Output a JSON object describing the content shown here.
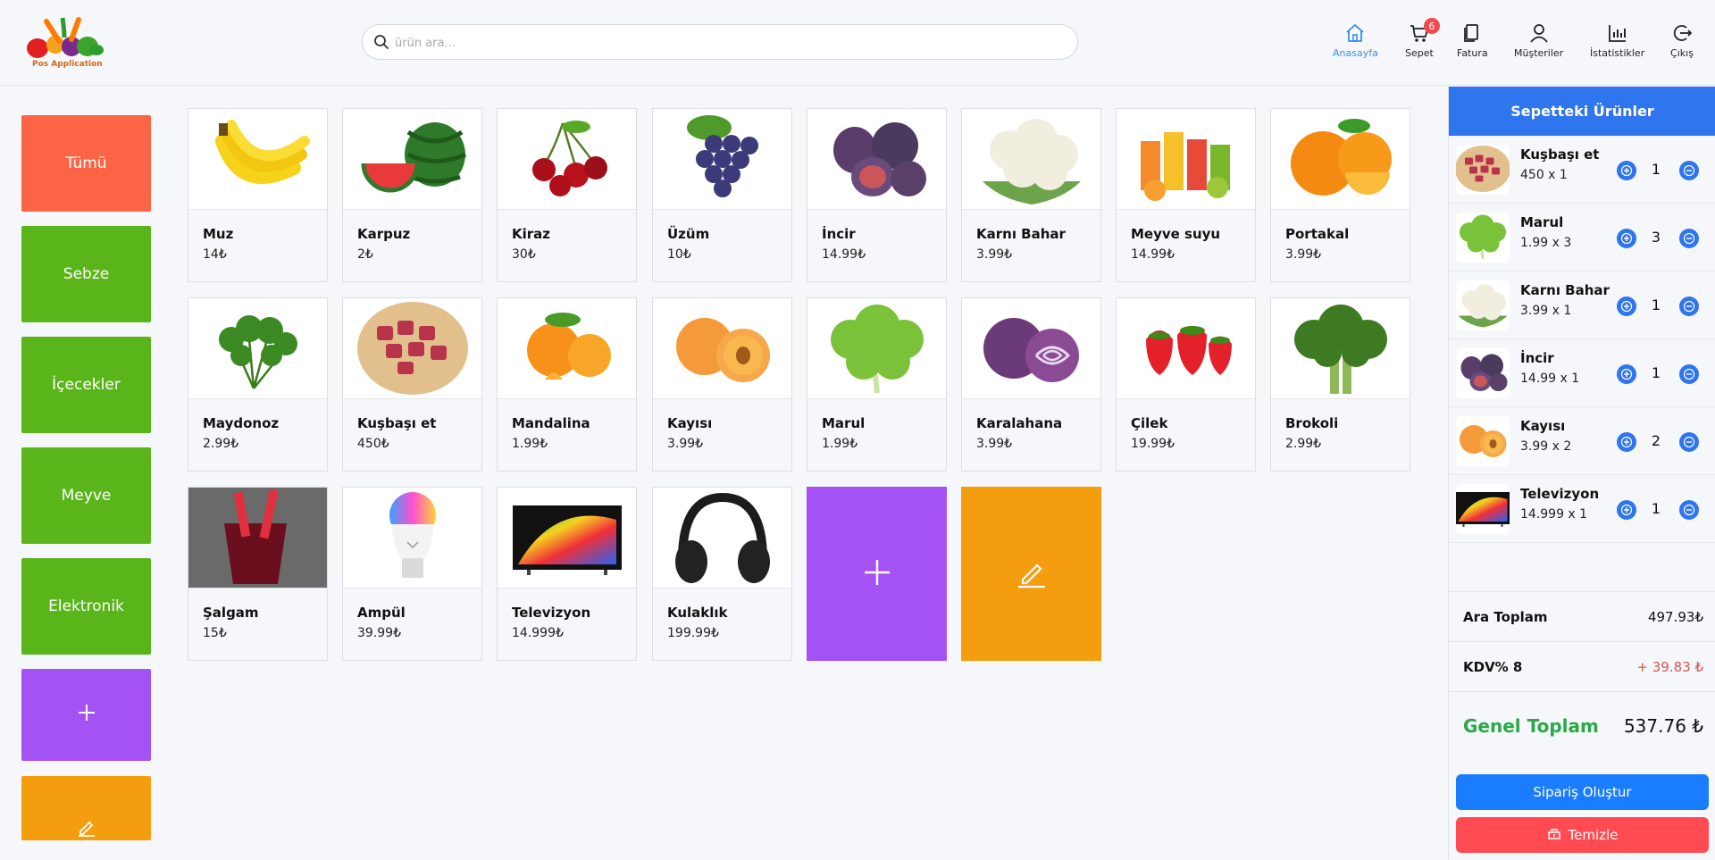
{
  "app": {
    "logo_text": "Pos Application",
    "search_placeholder": "ürün ara..."
  },
  "nav": [
    {
      "label": "Anasayfa",
      "icon": "home-icon",
      "active": true
    },
    {
      "label": "Sepet",
      "icon": "cart-icon",
      "badge": "6"
    },
    {
      "label": "Fatura",
      "icon": "invoice-icon"
    },
    {
      "label": "Müşteriler",
      "icon": "user-icon"
    },
    {
      "label": "İstatistikler",
      "icon": "chart-icon"
    },
    {
      "label": "Çıkış",
      "icon": "logout-icon"
    }
  ],
  "categories": [
    {
      "label": "Tümü"
    },
    {
      "label": "Sebze"
    },
    {
      "label": "İçecekler"
    },
    {
      "label": "Meyve"
    },
    {
      "label": "Elektronik"
    }
  ],
  "products": [
    {
      "name": "Muz",
      "price": "14₺",
      "icon": "banana-icon"
    },
    {
      "name": "Karpuz",
      "price": "2₺",
      "icon": "watermelon-icon"
    },
    {
      "name": "Kiraz",
      "price": "30₺",
      "icon": "cherry-icon"
    },
    {
      "name": "Üzüm",
      "price": "10₺",
      "icon": "grape-icon"
    },
    {
      "name": "İncir",
      "price": "14.99₺",
      "icon": "fig-icon"
    },
    {
      "name": "Karnı Bahar",
      "price": "3.99₺",
      "icon": "cauliflower-icon"
    },
    {
      "name": "Meyve suyu",
      "price": "14.99₺",
      "icon": "juice-icon"
    },
    {
      "name": "Portakal",
      "price": "3.99₺",
      "icon": "orange-icon"
    },
    {
      "name": "Maydonoz",
      "price": "2.99₺",
      "icon": "parsley-icon"
    },
    {
      "name": "Kuşbaşı et",
      "price": "450₺",
      "icon": "meat-icon"
    },
    {
      "name": "Mandalina",
      "price": "1.99₺",
      "icon": "tangerine-icon"
    },
    {
      "name": "Kayısı",
      "price": "3.99₺",
      "icon": "apricot-icon"
    },
    {
      "name": "Marul",
      "price": "1.99₺",
      "icon": "lettuce-icon"
    },
    {
      "name": "Karalahana",
      "price": "3.99₺",
      "icon": "cabbage-icon"
    },
    {
      "name": "Çilek",
      "price": "19.99₺",
      "icon": "strawberry-icon"
    },
    {
      "name": "Brokoli",
      "price": "2.99₺",
      "icon": "broccoli-icon"
    },
    {
      "name": "Şalgam",
      "price": "15₺",
      "icon": "turnip-juice-icon"
    },
    {
      "name": "Ampül",
      "price": "39.99₺",
      "icon": "bulb-icon"
    },
    {
      "name": "Televizyon",
      "price": "14.999₺",
      "icon": "tv-icon"
    },
    {
      "name": "Kulaklık",
      "price": "199.99₺",
      "icon": "headphones-icon"
    }
  ],
  "cart": {
    "title": "Sepetteki Ürünler",
    "items": [
      {
        "name": "Kuşbaşı et",
        "price": "450 x 1",
        "qty": "1",
        "icon": "meat-icon"
      },
      {
        "name": "Marul",
        "price": "1.99 x 3",
        "qty": "3",
        "icon": "lettuce-icon"
      },
      {
        "name": "Karnı Bahar",
        "price": "3.99 x 1",
        "qty": "1",
        "icon": "cauliflower-icon"
      },
      {
        "name": "İncir",
        "price": "14.99 x 1",
        "qty": "1",
        "icon": "fig-icon"
      },
      {
        "name": "Kayısı",
        "price": "3.99 x 2",
        "qty": "2",
        "icon": "apricot-icon"
      },
      {
        "name": "Televizyon",
        "price": "14.999 x 1",
        "qty": "1",
        "icon": "tv-icon"
      }
    ],
    "subtotal_label": "Ara Toplam",
    "subtotal_value": "497.93₺",
    "tax_label": "KDV% 8",
    "tax_value": "+ 39.83 ₺",
    "total_label": "Genel Toplam",
    "total_value": "537.76 ₺",
    "order_button": "Sipariş Oluştur",
    "clear_button": "Temizle"
  },
  "colors": {
    "accent_blue": "#2f75ee",
    "category_all": "#fb6545",
    "category_green": "#5ab51b",
    "tile_purple": "#a552f5",
    "tile_orange": "#f49e0f",
    "total_green": "#2aa84a",
    "tax_red": "#d9534f"
  }
}
